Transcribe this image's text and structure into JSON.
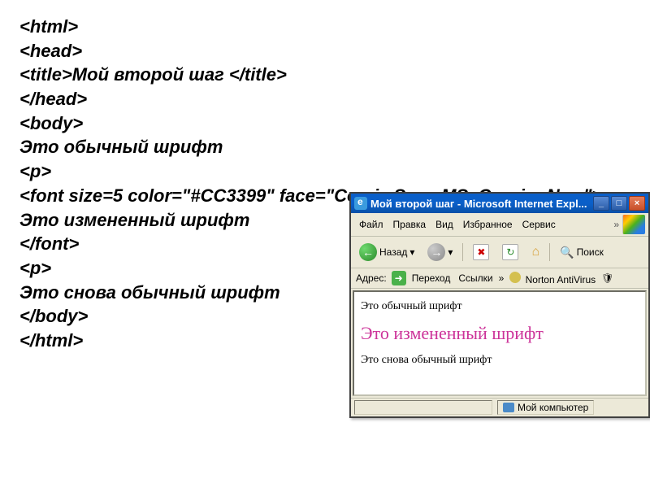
{
  "code": {
    "lines": [
      "<html>",
      "<head>",
      "<title>Мой второй шаг </title>",
      "</head>",
      "<body>",
      "Это обычный шрифт",
      "<p>",
      "<font size=5 color=\"#CC3399\" face=\"Comic Sans MS, Courier New\">",
      "Это измененный шрифт",
      "</font>",
      "<p>",
      "Это снова обычный шрифт",
      "</body>",
      "</html>"
    ]
  },
  "browser": {
    "title": "Мой второй шаг - Microsoft Internet Expl...",
    "menu": {
      "file": "Файл",
      "edit": "Правка",
      "view": "Вид",
      "favorites": "Избранное",
      "tools": "Сервис"
    },
    "toolbar": {
      "back": "Назад",
      "search": "Поиск"
    },
    "address": {
      "label": "Адрес:",
      "go": "Переход",
      "links": "Ссылки",
      "norton": "Norton AntiVirus"
    },
    "content": {
      "text1": "Это обычный шрифт",
      "text2": "Это измененный шрифт",
      "text3": "Это снова обычный шрифт"
    },
    "status": {
      "computer": "Мой компьютер"
    }
  }
}
